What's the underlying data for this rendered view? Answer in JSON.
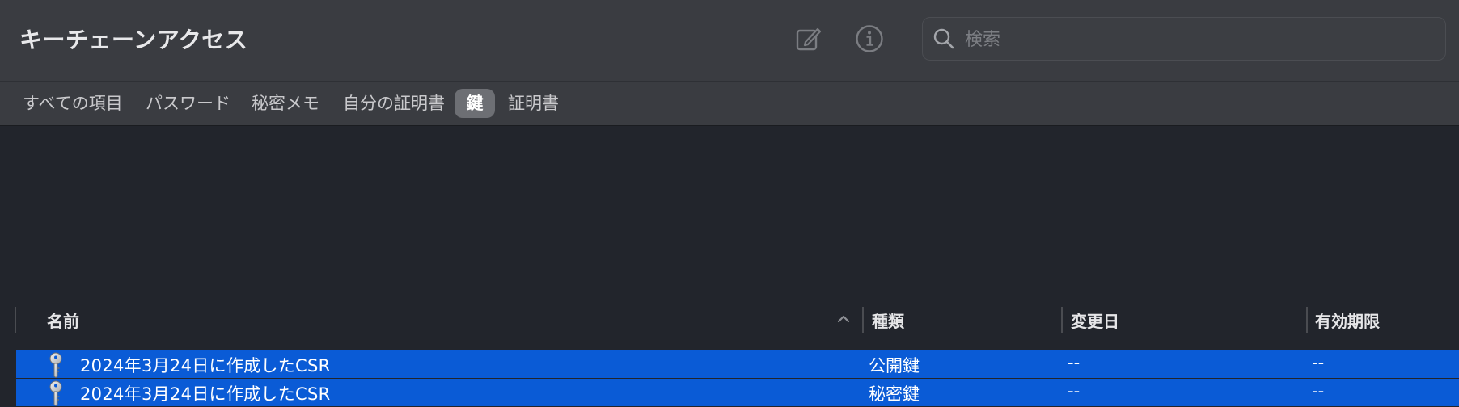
{
  "toolbar": {
    "title": "キーチェーンアクセス",
    "compose_icon": "compose-icon",
    "info_icon": "info-icon",
    "search_placeholder": "検索",
    "search_value": ""
  },
  "tabs": [
    {
      "label": "すべての項目",
      "active": false
    },
    {
      "label": "パスワード",
      "active": false
    },
    {
      "label": "秘密メモ",
      "active": false
    },
    {
      "label": "自分の証明書",
      "active": false
    },
    {
      "label": "鍵",
      "active": true
    },
    {
      "label": "証明書",
      "active": false
    }
  ],
  "table": {
    "columns": [
      "名前",
      "種類",
      "変更日",
      "有効期限"
    ],
    "sort": {
      "column": "名前",
      "direction": "ascending"
    },
    "rows": [
      {
        "icon": "key-icon",
        "name": "2024年3月24日に作成したCSR",
        "kind": "公開鍵",
        "modified": "--",
        "expires": "--",
        "selected": true
      },
      {
        "icon": "key-icon",
        "name": "2024年3月24日に作成したCSR",
        "kind": "秘密鍵",
        "modified": "--",
        "expires": "--",
        "selected": true
      }
    ]
  },
  "colors": {
    "toolbar_bg": "#3a3c41",
    "content_bg": "#22252c",
    "selection": "#0a5bd6",
    "active_tab": "#6d6f74"
  }
}
